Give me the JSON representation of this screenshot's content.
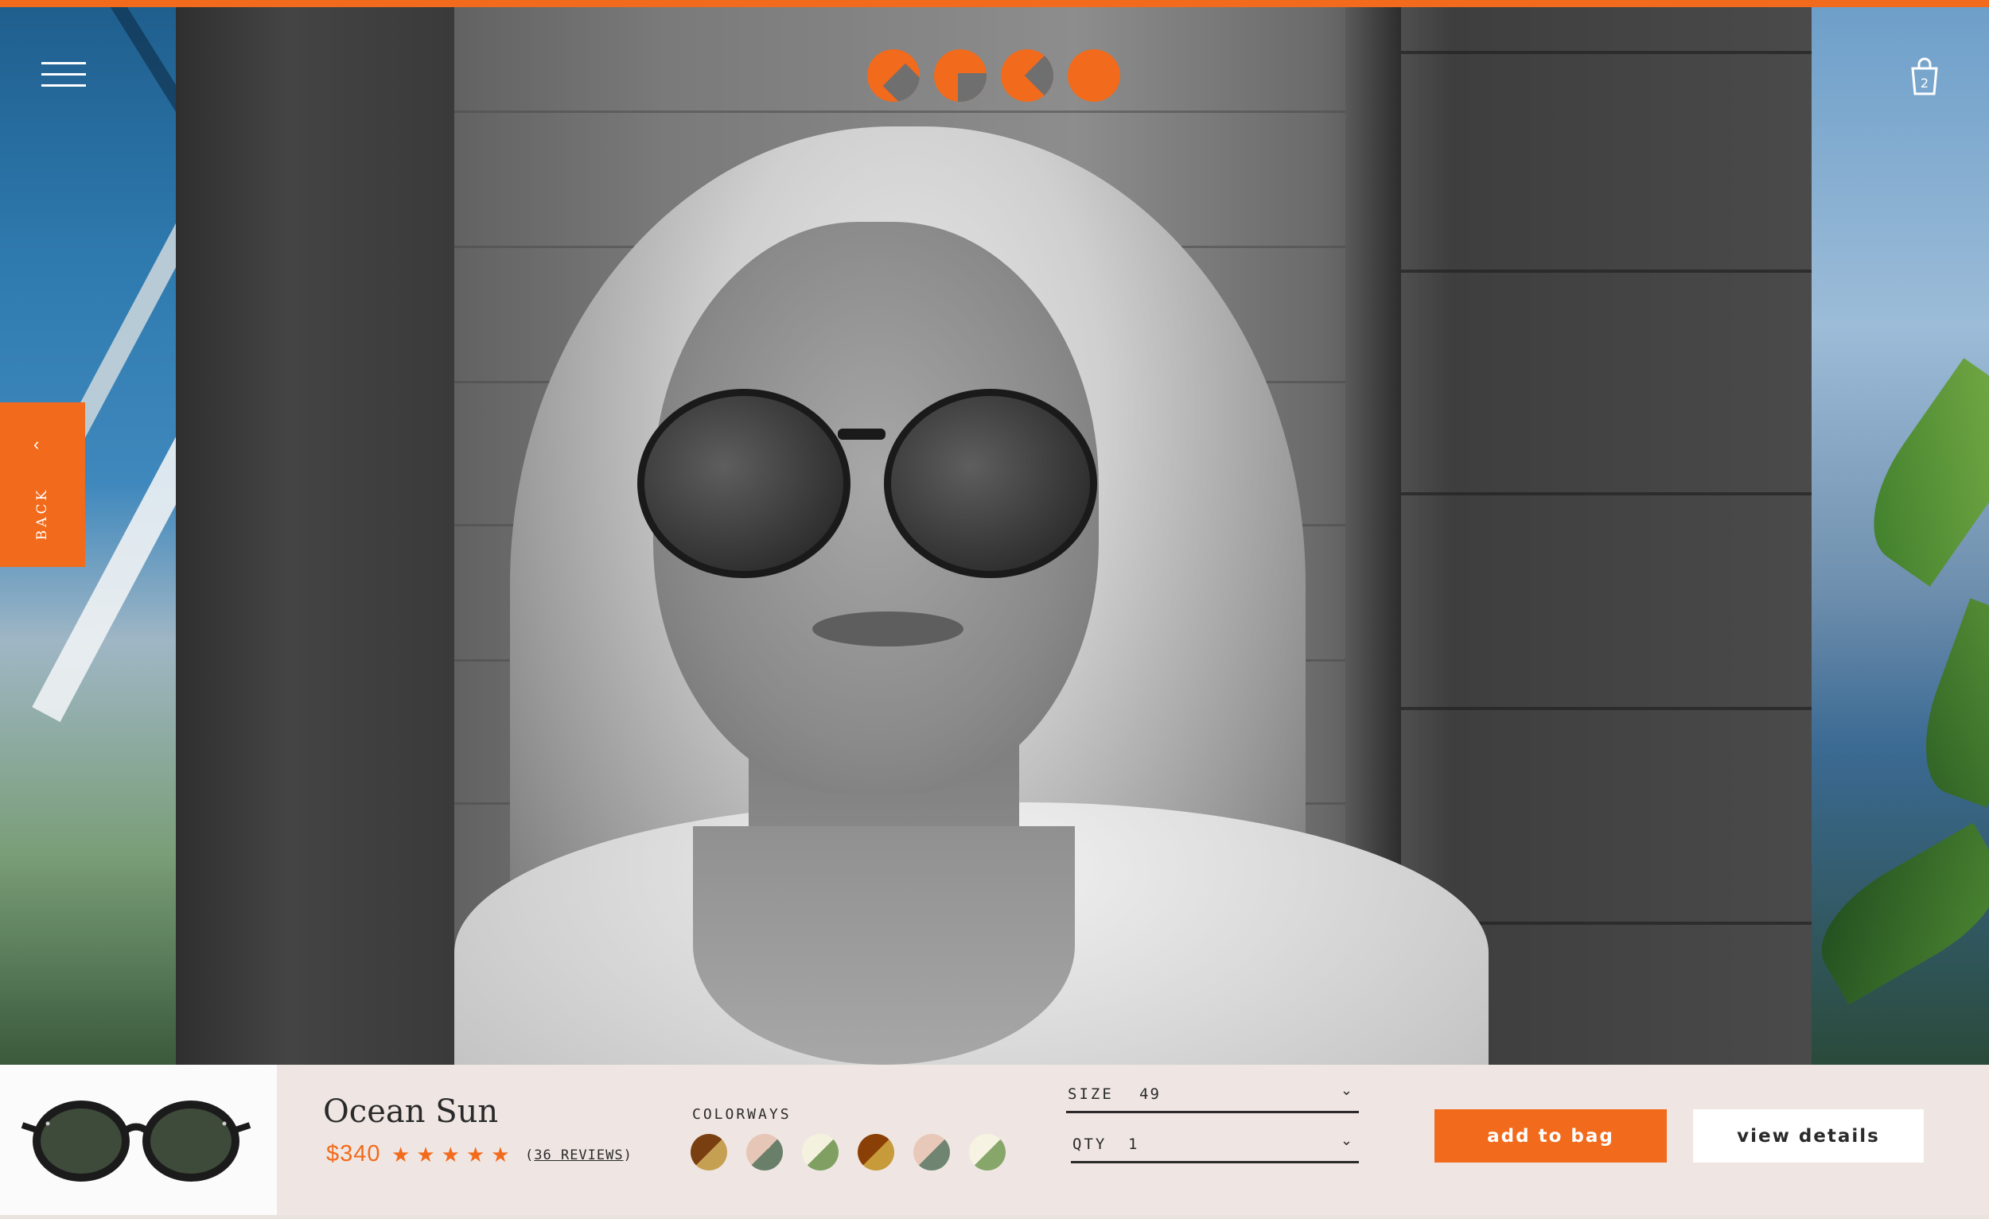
{
  "header": {
    "menu_icon": "hamburger-icon",
    "logo_alt": "",
    "cart_icon": "shopping-bag-icon",
    "cart_count": "2"
  },
  "colors": {
    "accent": "#f26a1b",
    "bar_background": "#efe6e3",
    "text": "#2a2a2a"
  },
  "back_tab": {
    "label": "BACK",
    "icon": "chevron-left-icon"
  },
  "product": {
    "name": "Ocean Sun",
    "price": "$340",
    "rating": 5,
    "reviews_open": "(",
    "reviews_text": "36 REVIEWS",
    "reviews_close": ")"
  },
  "colorways": {
    "label": "COLORWAYS",
    "swatches": [
      {
        "name": "tortoise-amber",
        "a": "#7a3f10",
        "b": "#c6a052"
      },
      {
        "name": "blush-sage",
        "a": "#e6c6b6",
        "b": "#6a7f6a"
      },
      {
        "name": "cream-green",
        "a": "#f4f2df",
        "b": "#7fa060"
      },
      {
        "name": "tortoise-gold",
        "a": "#8a3f06",
        "b": "#c79a3a"
      },
      {
        "name": "pink-sage",
        "a": "#e8c8b8",
        "b": "#6f8571"
      },
      {
        "name": "ivory-olive",
        "a": "#f6f3e3",
        "b": "#86a66a"
      }
    ]
  },
  "size": {
    "label": "SIZE",
    "value": "49"
  },
  "qty": {
    "label": "QTY",
    "value": "1"
  },
  "buttons": {
    "add_to_bag": "add to bag",
    "view_details": "view details"
  }
}
